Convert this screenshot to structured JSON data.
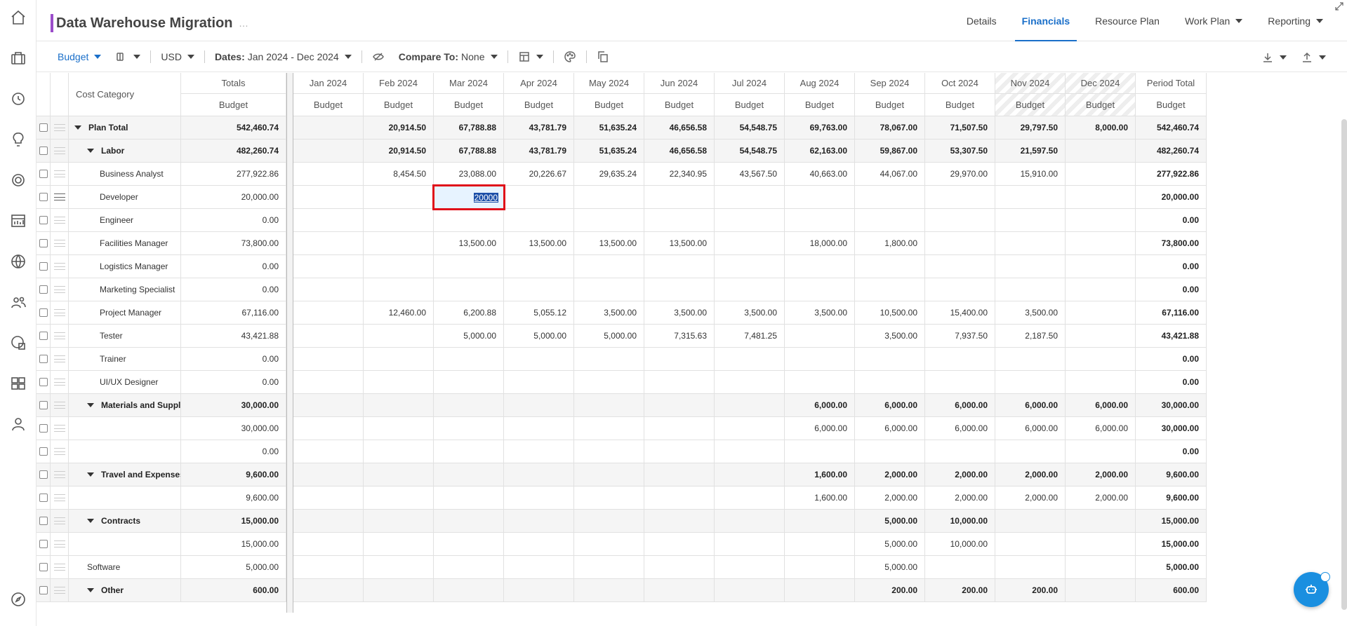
{
  "header": {
    "title": "Data Warehouse Migration",
    "title_menu": "…",
    "tabs": [
      {
        "label": "Details",
        "active": false,
        "dropdown": false
      },
      {
        "label": "Financials",
        "active": true,
        "dropdown": false
      },
      {
        "label": "Resource Plan",
        "active": false,
        "dropdown": false
      },
      {
        "label": "Work Plan",
        "active": false,
        "dropdown": true
      },
      {
        "label": "Reporting",
        "active": false,
        "dropdown": true
      }
    ]
  },
  "toolbar": {
    "view": "Budget",
    "currency": "USD",
    "dates_label": "Dates:",
    "dates_value": "Jan 2024 - Dec 2024",
    "compare_label": "Compare To:",
    "compare_value": "None"
  },
  "grid": {
    "category_header": "Cost Category",
    "totals_header": "Totals",
    "budget_label": "Budget",
    "months": [
      "Jan 2024",
      "Feb 2024",
      "Mar 2024",
      "Apr 2024",
      "May 2024",
      "Jun 2024",
      "Jul 2024",
      "Aug 2024",
      "Sep 2024",
      "Oct 2024",
      "Nov 2024",
      "Dec 2024"
    ],
    "period_total_header": "Period Total",
    "editing_value": "20000",
    "rows": [
      {
        "name": "Plan Total",
        "level": 0,
        "type": "group",
        "total": "542,460.74",
        "months": [
          "",
          "20,914.50",
          "67,788.88",
          "43,781.79",
          "51,635.24",
          "46,656.58",
          "54,548.75",
          "69,763.00",
          "78,067.00",
          "71,507.50",
          "29,797.50",
          "8,000.00"
        ],
        "period": "542,460.74"
      },
      {
        "name": "Labor",
        "level": 1,
        "type": "group",
        "total": "482,260.74",
        "months": [
          "",
          "20,914.50",
          "67,788.88",
          "43,781.79",
          "51,635.24",
          "46,656.58",
          "54,548.75",
          "62,163.00",
          "59,867.00",
          "53,307.50",
          "21,597.50",
          ""
        ],
        "period": "482,260.74"
      },
      {
        "name": "Business Analyst",
        "level": 2,
        "type": "item",
        "total": "277,922.86",
        "months": [
          "",
          "8,454.50",
          "23,088.00",
          "20,226.67",
          "29,635.24",
          "22,340.95",
          "43,567.50",
          "40,663.00",
          "44,067.00",
          "29,970.00",
          "15,910.00",
          ""
        ],
        "period": "277,922.86"
      },
      {
        "name": "Developer",
        "level": 2,
        "type": "item",
        "total": "20,000.00",
        "months": [
          "",
          "",
          "",
          "",
          "",
          "",
          "",
          "",
          "",
          "",
          "",
          ""
        ],
        "period": "20,000.00",
        "editing": true
      },
      {
        "name": "Engineer",
        "level": 2,
        "type": "item",
        "total": "0.00",
        "months": [
          "",
          "",
          "",
          "",
          "",
          "",
          "",
          "",
          "",
          "",
          "",
          ""
        ],
        "period": "0.00"
      },
      {
        "name": "Facilities Manager",
        "level": 2,
        "type": "item",
        "total": "73,800.00",
        "months": [
          "",
          "",
          "13,500.00",
          "13,500.00",
          "13,500.00",
          "13,500.00",
          "",
          "18,000.00",
          "1,800.00",
          "",
          "",
          ""
        ],
        "period": "73,800.00"
      },
      {
        "name": "Logistics Manager",
        "level": 2,
        "type": "item",
        "total": "0.00",
        "months": [
          "",
          "",
          "",
          "",
          "",
          "",
          "",
          "",
          "",
          "",
          "",
          ""
        ],
        "period": "0.00"
      },
      {
        "name": "Marketing Specialist",
        "level": 2,
        "type": "item",
        "total": "0.00",
        "months": [
          "",
          "",
          "",
          "",
          "",
          "",
          "",
          "",
          "",
          "",
          "",
          ""
        ],
        "period": "0.00"
      },
      {
        "name": "Project Manager",
        "level": 2,
        "type": "item",
        "total": "67,116.00",
        "months": [
          "",
          "12,460.00",
          "6,200.88",
          "5,055.12",
          "3,500.00",
          "3,500.00",
          "3,500.00",
          "3,500.00",
          "10,500.00",
          "15,400.00",
          "3,500.00",
          ""
        ],
        "period": "67,116.00"
      },
      {
        "name": "Tester",
        "level": 2,
        "type": "item",
        "total": "43,421.88",
        "months": [
          "",
          "",
          "5,000.00",
          "5,000.00",
          "5,000.00",
          "7,315.63",
          "7,481.25",
          "",
          "3,500.00",
          "7,937.50",
          "2,187.50",
          ""
        ],
        "period": "43,421.88"
      },
      {
        "name": "Trainer",
        "level": 2,
        "type": "item",
        "total": "0.00",
        "months": [
          "",
          "",
          "",
          "",
          "",
          "",
          "",
          "",
          "",
          "",
          "",
          ""
        ],
        "period": "0.00"
      },
      {
        "name": "UI/UX Designer",
        "level": 2,
        "type": "item",
        "total": "0.00",
        "months": [
          "",
          "",
          "",
          "",
          "",
          "",
          "",
          "",
          "",
          "",
          "",
          ""
        ],
        "period": "0.00"
      },
      {
        "name": "Materials and Supplies",
        "level": 1,
        "type": "group",
        "total": "30,000.00",
        "months": [
          "",
          "",
          "",
          "",
          "",
          "",
          "",
          "6,000.00",
          "6,000.00",
          "6,000.00",
          "6,000.00",
          "6,000.00"
        ],
        "period": "30,000.00"
      },
      {
        "name": "",
        "level": 2,
        "type": "item",
        "total": "30,000.00",
        "months": [
          "",
          "",
          "",
          "",
          "",
          "",
          "",
          "6,000.00",
          "6,000.00",
          "6,000.00",
          "6,000.00",
          "6,000.00"
        ],
        "period": "30,000.00"
      },
      {
        "name": "",
        "level": 2,
        "type": "item",
        "total": "0.00",
        "months": [
          "",
          "",
          "",
          "",
          "",
          "",
          "",
          "",
          "",
          "",
          "",
          ""
        ],
        "period": "0.00"
      },
      {
        "name": "Travel and Expenses",
        "level": 1,
        "type": "group",
        "total": "9,600.00",
        "months": [
          "",
          "",
          "",
          "",
          "",
          "",
          "",
          "1,600.00",
          "2,000.00",
          "2,000.00",
          "2,000.00",
          "2,000.00"
        ],
        "period": "9,600.00"
      },
      {
        "name": "",
        "level": 2,
        "type": "item",
        "total": "9,600.00",
        "months": [
          "",
          "",
          "",
          "",
          "",
          "",
          "",
          "1,600.00",
          "2,000.00",
          "2,000.00",
          "2,000.00",
          "2,000.00"
        ],
        "period": "9,600.00"
      },
      {
        "name": "Contracts",
        "level": 1,
        "type": "group",
        "total": "15,000.00",
        "months": [
          "",
          "",
          "",
          "",
          "",
          "",
          "",
          "",
          "5,000.00",
          "10,000.00",
          "",
          ""
        ],
        "period": "15,000.00"
      },
      {
        "name": "",
        "level": 2,
        "type": "item",
        "total": "15,000.00",
        "months": [
          "",
          "",
          "",
          "",
          "",
          "",
          "",
          "",
          "5,000.00",
          "10,000.00",
          "",
          ""
        ],
        "period": "15,000.00"
      },
      {
        "name": "Software",
        "level": 1,
        "type": "item",
        "total": "5,000.00",
        "months": [
          "",
          "",
          "",
          "",
          "",
          "",
          "",
          "",
          "5,000.00",
          "",
          "",
          ""
        ],
        "period": "5,000.00"
      },
      {
        "name": "Other",
        "level": 1,
        "type": "group",
        "total": "600.00",
        "months": [
          "",
          "",
          "",
          "",
          "",
          "",
          "",
          "",
          "200.00",
          "200.00",
          "200.00",
          ""
        ],
        "period": "600.00"
      }
    ]
  }
}
